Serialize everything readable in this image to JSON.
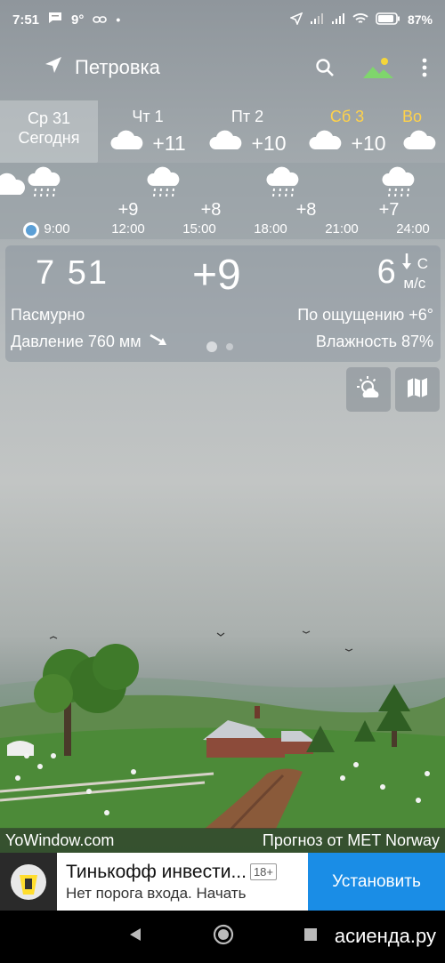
{
  "status_bar": {
    "time": "7:51",
    "temp_small": "9°",
    "battery": "87%"
  },
  "app_bar": {
    "location": "Петровка",
    "icons": [
      "location-arrow-icon",
      "search-icon",
      "landscape-icon",
      "more-vert-icon"
    ]
  },
  "days": [
    {
      "name": "Ср 31",
      "label2": "Сегодня"
    },
    {
      "name": "Чт 1",
      "temp": "+11"
    },
    {
      "name": "Пт 2",
      "temp": "+10"
    },
    {
      "name": "Сб 3",
      "temp": "+10"
    },
    {
      "name": "Во"
    }
  ],
  "hourly": {
    "temps": [
      "+9",
      "+8",
      "+8",
      "+7"
    ],
    "times": [
      "9:00",
      "12:00",
      "15:00",
      "18:00",
      "21:00",
      "24:00"
    ]
  },
  "current": {
    "time": "7 51",
    "temp": "+9",
    "wind_speed": "6",
    "wind_dir": "С",
    "wind_unit": "м/с",
    "condition": "Пасмурно",
    "feels_like": "По ощущению +6°",
    "pressure": "Давление 760 мм",
    "humidity": "Влажность 87%"
  },
  "credit": {
    "left": "YoWindow.com",
    "right": "Прогноз от MET Norway"
  },
  "ad": {
    "title": "Тинькофф инвести...",
    "badge": "18+",
    "subtitle": "Нет порога входа. Начать",
    "button": "Установить"
  },
  "watermark": "асиенда.ру",
  "colors": {
    "saturday": "#ffd24a",
    "ad_button": "#1a8de6"
  }
}
